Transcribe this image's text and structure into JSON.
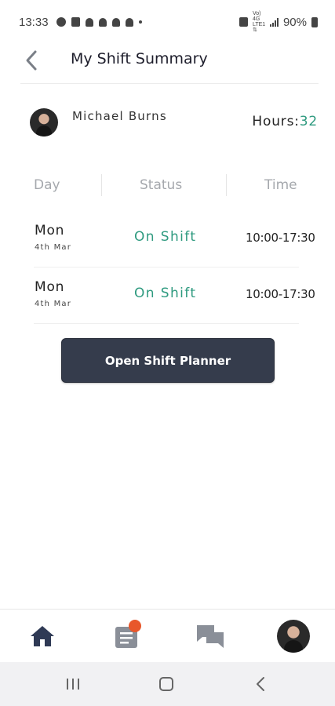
{
  "status_bar": {
    "time": "13:33",
    "battery": "90%",
    "network_label": "VoLTE 4G LTE1"
  },
  "header": {
    "title": "My Shift Summary"
  },
  "profile": {
    "name": "Michael Burns",
    "hours_label": "Hours:",
    "hours_value": "32"
  },
  "table": {
    "columns": [
      "Day",
      "Status",
      "Time"
    ],
    "rows": [
      {
        "day": "Mon",
        "date": "4th Mar",
        "status": "On Shift",
        "time": "10:00-17:30"
      },
      {
        "day": "Mon",
        "date": "4th Mar",
        "status": "On Shift",
        "time": "10:00-17:30"
      }
    ]
  },
  "actions": {
    "open_planner_label": "Open Shift Planner"
  },
  "bottom_nav": {
    "items": [
      {
        "icon": "home-icon",
        "active": true
      },
      {
        "icon": "document-icon",
        "badge": true
      },
      {
        "icon": "chat-icon"
      },
      {
        "icon": "profile-avatar"
      }
    ]
  },
  "colors": {
    "accent": "#2e9a7f",
    "button_bg": "#353c4c",
    "badge": "#e8572b",
    "nav_active": "#2f3a55",
    "nav_inactive": "#8a8f98"
  }
}
